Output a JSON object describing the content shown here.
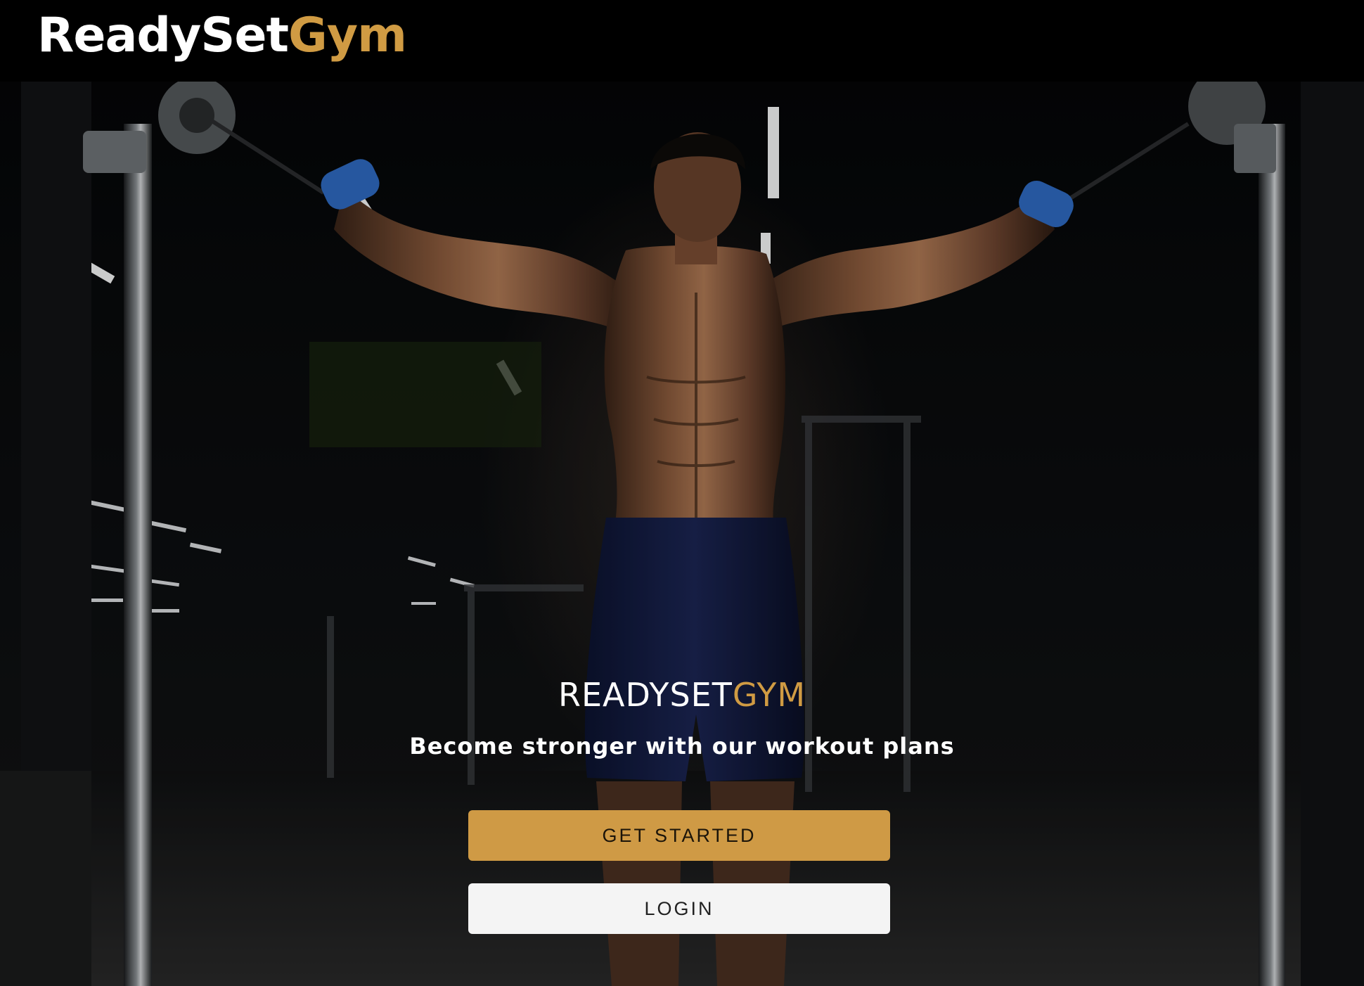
{
  "brand": {
    "name_part1": "ReadySet",
    "name_part2": "Gym"
  },
  "hero": {
    "title_part1": "READYSET",
    "title_part2": "GYM",
    "subtitle": "Become stronger with our workout plans",
    "get_started_label": "GET STARTED",
    "login_label": "LOGIN",
    "background_image": "gym-athlete-cable-crossover-photo"
  },
  "colors": {
    "accent": "#d09b43",
    "button_primary": "#cf9a45",
    "button_secondary": "#f4f4f4",
    "navbar": "#000000"
  }
}
